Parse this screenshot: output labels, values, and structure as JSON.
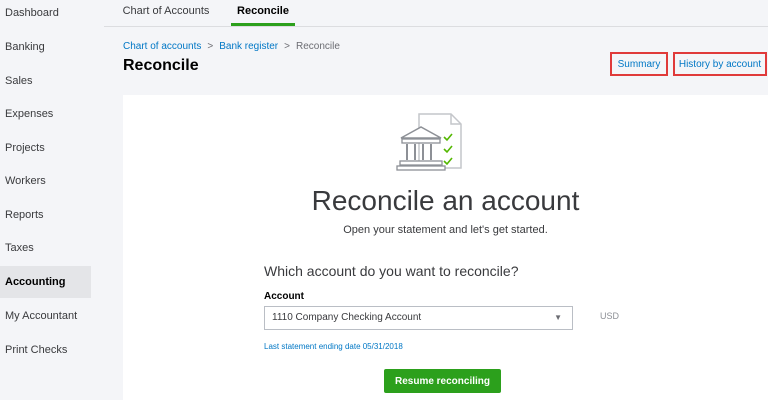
{
  "sidebar": {
    "items": [
      {
        "label": "Dashboard"
      },
      {
        "label": "Banking"
      },
      {
        "label": "Sales"
      },
      {
        "label": "Expenses"
      },
      {
        "label": "Projects"
      },
      {
        "label": "Workers"
      },
      {
        "label": "Reports"
      },
      {
        "label": "Taxes"
      },
      {
        "label": "Accounting",
        "active": true
      },
      {
        "label": "My Accountant"
      },
      {
        "label": "Print Checks"
      }
    ]
  },
  "tabs": [
    {
      "label": "Chart of Accounts"
    },
    {
      "label": "Reconcile",
      "active": true
    }
  ],
  "breadcrumb": {
    "items": [
      "Chart of accounts",
      "Bank register",
      "Reconcile"
    ],
    "separator": ">"
  },
  "page": {
    "title": "Reconcile",
    "summary_link": "Summary",
    "history_link": "History by account"
  },
  "card": {
    "title": "Reconcile an account",
    "subtitle": "Open your statement and let's get started.",
    "question": "Which account do you want to reconcile?",
    "account_label": "Account",
    "account_value": "1110 Company Checking Account",
    "currency": "USD",
    "last_statement": "Last statement ending date 05/31/2018",
    "resume_button": "Resume reconciling"
  },
  "colors": {
    "accent_green": "#2ca01c",
    "link_blue": "#0077c5",
    "highlight_red": "#e03a3a"
  }
}
